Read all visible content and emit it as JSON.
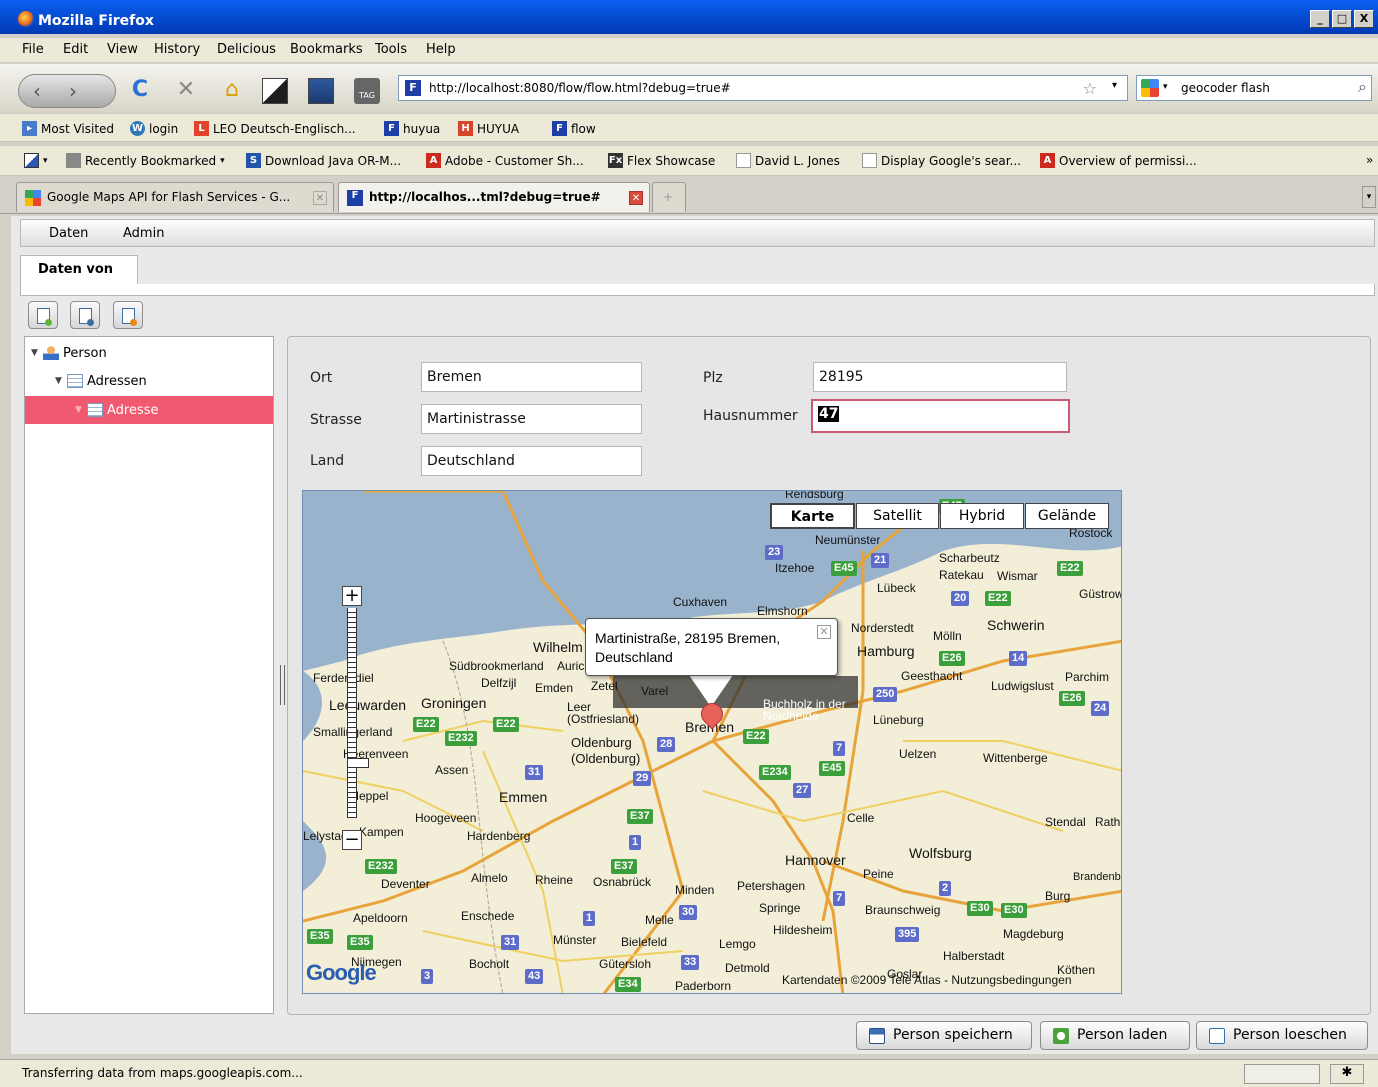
{
  "window": {
    "title": "Mozilla Firefox",
    "buttons": [
      "_",
      "□",
      "X"
    ]
  },
  "menu": [
    "File",
    "Edit",
    "View",
    "History",
    "Delicious",
    "Bookmarks",
    "Tools",
    "Help"
  ],
  "nav": {
    "url": "http://localhost:8080/flow/flow.html?debug=true#",
    "search": "geocoder flash"
  },
  "bookmarks1": [
    "Most Visited",
    "login",
    "LEO Deutsch-Englisch...",
    "huyua",
    "HUYUA",
    "flow"
  ],
  "bookmarks2": [
    "Recently Bookmarked",
    "Download Java OR-M...",
    "Adobe - Customer Sh...",
    "Flex Showcase",
    "David L. Jones",
    "Display Google's sear...",
    "Overview of permissi..."
  ],
  "tabs": [
    "Google Maps API for Flash Services - G...",
    "http://localhos...tml?debug=true#"
  ],
  "app": {
    "menu": [
      "Daten",
      "Admin"
    ],
    "tab": "Daten von",
    "tree": [
      "Person",
      "Adressen",
      "Adresse"
    ],
    "form": {
      "ort_label": "Ort",
      "ort": "Bremen",
      "strasse_label": "Strasse",
      "strasse": "Martinistrasse",
      "land_label": "Land",
      "land": "Deutschland",
      "plz_label": "Plz",
      "plz": "28195",
      "hausnummer_label": "Hausnummer",
      "hausnummer": "47"
    },
    "map": {
      "types": [
        "Karte",
        "Satellit",
        "Hybrid",
        "Gelände"
      ],
      "active_type": "Karte",
      "bubble_line1": "Martinistraße, 28195 Bremen,",
      "bubble_line2": "Deutschland",
      "attribution": "Kartendaten ©2009 Tele Atlas - Nutzungsbedingungen",
      "logo": "Google",
      "cities": [
        "Rendsburg",
        "Rostock",
        "Neumünster",
        "Itzehoe",
        "Scharbeutz",
        "Ratekau",
        "Wismar",
        "Lübeck",
        "Güstrow",
        "Cuxhaven",
        "Elmshorn",
        "Norderstedt",
        "Mölln",
        "Schwerin",
        "Wilhelm",
        "Hamburg",
        "Parchim",
        "Südbrookmerland",
        "Aurich",
        "Ferderadiel",
        "Delfzijl",
        "Emden",
        "Zetel",
        "Varel",
        "Geesthacht",
        "Ludwigslust",
        "Leeuwarden",
        "Groningen",
        "Leer (Ostfriesland)",
        "Buchholz in der Nordheide",
        "Lüneburg",
        "Smallingerland",
        "Bremen",
        "Oldenburg (Oldenburg)",
        "Uelzen",
        "Wittenberge",
        "Heerenveen",
        "Assen",
        "Emmen",
        "Meppel",
        "Hoogeveen",
        "Hardenberg",
        "Celle",
        "Stendal",
        "Rathenow",
        "Lelystad",
        "Kampen",
        "Hannover",
        "Peine",
        "Wolfsburg",
        "Deventer",
        "Almelo",
        "Rheine",
        "Osnabrück",
        "Minden",
        "Petershagen",
        "Burg",
        "Brandenburg an der Havel",
        "Apeldoorn",
        "Enschede",
        "Melle",
        "Springe",
        "Braunschweig",
        "Hildesheim",
        "Magdeburg",
        "Münster",
        "Bielefeld",
        "Lemgo",
        "Nijmegen",
        "Bocholt",
        "Gütersloh",
        "Detmold",
        "Halberstadt",
        "Goslar",
        "Köthen",
        "Paderborn"
      ],
      "roads": [
        "23",
        "E45",
        "21",
        "E47",
        "E22",
        "20",
        "E22",
        "E26",
        "14",
        "250",
        "E26",
        "24",
        "E22",
        "E22",
        "E232",
        "28",
        "E22",
        "7",
        "E45",
        "31",
        "29",
        "E234",
        "27",
        "E37",
        "1",
        "E37",
        "E232",
        "7",
        "2",
        "E30",
        "E30",
        "30",
        "1",
        "31",
        "395",
        "E35",
        "E35",
        "43",
        "3",
        "33",
        "E34"
      ]
    },
    "buttons": {
      "save": "Person speichern",
      "load": "Person laden",
      "delete": "Person loeschen"
    }
  },
  "status": "Transferring data from maps.googleapis.com..."
}
